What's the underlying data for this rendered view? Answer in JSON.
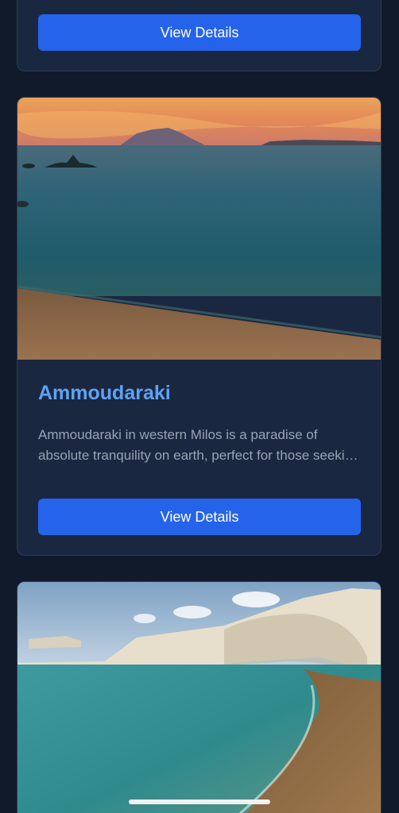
{
  "cards": [
    {
      "button_label": "View Details"
    },
    {
      "image_alt": "Ammoudaraki",
      "title": "Ammoudaraki",
      "description": "Ammoudaraki in western Milos is a paradise of absolute tranquility on earth, perfect for those seeking peace and relaxation.",
      "button_label": "View Details"
    },
    {
      "image_alt": ""
    }
  ],
  "colors": {
    "background": "#111a2b",
    "card": "#1a2740",
    "accent_button": "#2563eb",
    "title": "#5ea2f5",
    "description": "#97a3b6"
  }
}
